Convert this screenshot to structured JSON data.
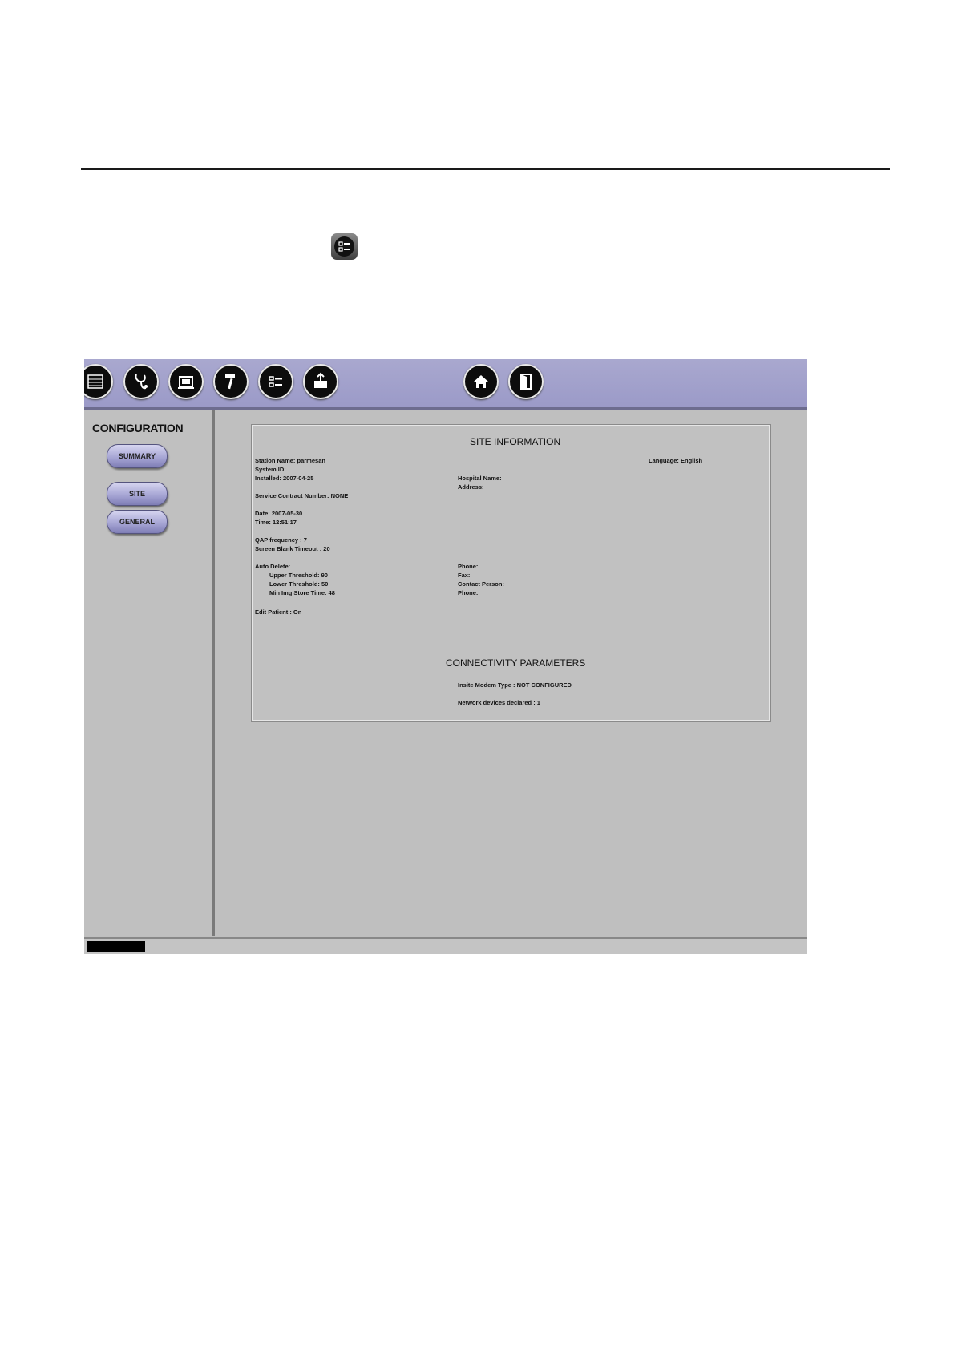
{
  "site_info_title": "SITE INFORMATION",
  "connectivity_title": "CONNECTIVITY PARAMETERS",
  "sidebar": {
    "title": "CONFIGURATION",
    "buttons": [
      {
        "label": "SUMMARY"
      },
      {
        "label": "SITE"
      },
      {
        "label": "GENERAL"
      }
    ]
  },
  "toolbar": {
    "icons": [
      "list-icon",
      "stethoscope-icon",
      "screen-icon",
      "tools-icon",
      "checklist-icon",
      "export-icon",
      "home-icon",
      "exit-icon"
    ]
  },
  "site": {
    "station_name": "Station Name: parmesan",
    "system_id": "System ID:",
    "installed": "Installed: 2007-04-25",
    "service_contract": "Service Contract Number: NONE",
    "date": "Date: 2007-05-30",
    "time": "Time: 12:51:17",
    "qap_frequency": "QAP frequency : 7",
    "screen_blank": "Screen Blank Timeout : 20",
    "auto_delete": "Auto Delete:",
    "upper_threshold": "Upper Threshold: 90",
    "lower_threshold": "Lower Threshold: 50",
    "min_img_store": "Min Img Store Time: 48",
    "edit_patient": "Edit Patient : On",
    "language": "Language: English",
    "hospital_name": "Hospital Name:",
    "address": "Address:",
    "phone": "Phone:",
    "fax": "Fax:",
    "contact_person": "Contact Person:",
    "contact_phone": "Phone:"
  },
  "connectivity": {
    "insite_modem": "Insite Modem Type : NOT CONFIGURED",
    "network_devices": "Network devices declared : 1"
  }
}
